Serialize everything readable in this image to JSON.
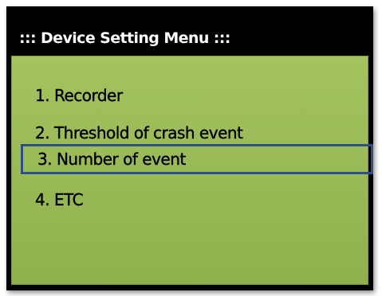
{
  "menu": {
    "title": "::: Device Setting Menu :::",
    "items": [
      {
        "label": "1. Recorder",
        "selected": false
      },
      {
        "label": "2. Threshold of crash event",
        "selected": false
      },
      {
        "label": "3. Number of event",
        "selected": true
      },
      {
        "label": "4. ETC",
        "selected": false
      }
    ]
  },
  "colors": {
    "screen_background": "#000000",
    "panel_background": "#9bbb59",
    "selection_border": "#2f4f86",
    "title_text": "#ffffff",
    "item_text": "#000000"
  }
}
